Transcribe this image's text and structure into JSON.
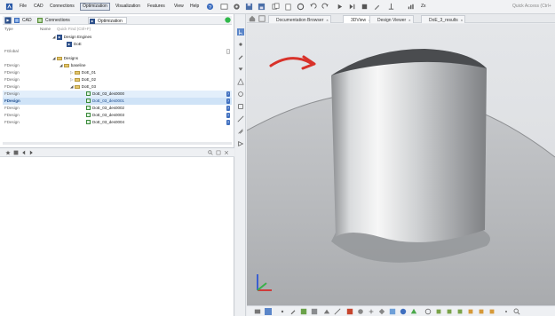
{
  "menubar": {
    "items": [
      "File",
      "CAD",
      "Connections",
      "Optimization",
      "Visualization",
      "Features",
      "View",
      "Help"
    ],
    "active": "Optimization",
    "quick_access": "Quick Access (Ctrl+"
  },
  "left_panel": {
    "tabs": [
      "CAD",
      "Connections",
      "Optimization"
    ],
    "column_type": "Type",
    "column_name": "Name",
    "quick_find": "Quick Find (Ctrl+F)",
    "rows": [
      {
        "type": "",
        "label": "Design Engines",
        "indent": 1
      },
      {
        "type": "",
        "label": "DoE",
        "indent": 2
      },
      {
        "type": "FGlobal",
        "label": "",
        "indent": 0
      },
      {
        "type": "",
        "label": "Designs",
        "indent": 1
      },
      {
        "type": "FDesign",
        "label": "baseline",
        "indent": 2
      },
      {
        "type": "FDesign",
        "label": "DoE_01",
        "indent": 3
      },
      {
        "type": "FDesign",
        "label": "DoE_02",
        "indent": 3
      },
      {
        "type": "FDesign",
        "label": "DoE_03",
        "indent": 3
      },
      {
        "type": "FDesign",
        "label": "DoE_03_des0000",
        "indent": 4
      },
      {
        "type": "FDesign",
        "label": "DoE_03_des0001",
        "indent": 4
      },
      {
        "type": "FDesign",
        "label": "DoE_03_des0002",
        "indent": 4
      },
      {
        "type": "FDesign",
        "label": "DoE_03_des0003",
        "indent": 4
      },
      {
        "type": "FDesign",
        "label": "DoE_03_des0004",
        "indent": 4
      }
    ]
  },
  "view_tabs": [
    {
      "label": "Documentation Browser",
      "active": false
    },
    {
      "label": "3DView",
      "active": true
    },
    {
      "label": "Design Viewer",
      "active": false
    },
    {
      "label": "DoE_3_results",
      "active": false
    }
  ],
  "tab_close": "×",
  "toolbar_extra": "Zx",
  "colors": {
    "selected_row": "#cfe3f7",
    "accent_blue": "#3f6fbf",
    "arrow_red": "#d8322a",
    "viewport_bg": "#e2e4e7"
  }
}
